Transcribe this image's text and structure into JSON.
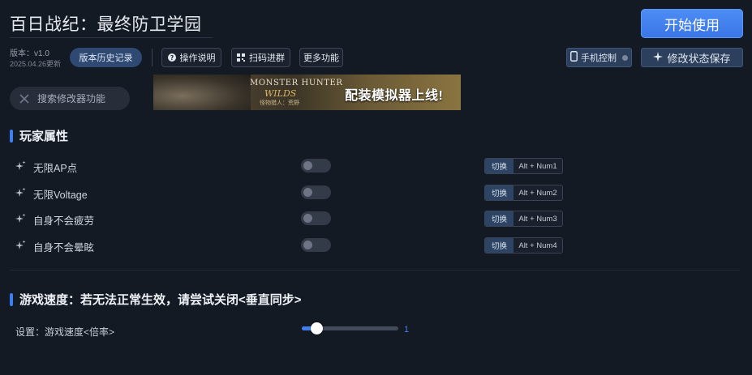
{
  "header": {
    "title": "百日战纪：最终防卫学园",
    "start_button": "开始使用",
    "version_label": "版本：v1.0",
    "version_date": "2025.04.26更新",
    "history_button": "版本历史记录",
    "instructions_button": "操作说明",
    "qr_button": "扫码进群",
    "more_button": "更多功能",
    "phone_button": "手机控制",
    "save_button": "修改状态保存"
  },
  "search": {
    "placeholder": "搜索修改器功能"
  },
  "banner": {
    "brand_line1": "MONSTER HUNTER",
    "brand_line2": "WILDS",
    "brand_line3": "怪物猎人：荒野",
    "headline": "配装模拟器上线!"
  },
  "player_section": {
    "title": "玩家属性",
    "toggle_label": "切换",
    "features": [
      {
        "name": "无限AP点",
        "hotkey": "Alt + Num1",
        "enabled": false
      },
      {
        "name": "无限Voltage",
        "hotkey": "Alt + Num2",
        "enabled": false
      },
      {
        "name": "自身不会疲劳",
        "hotkey": "Alt + Num3",
        "enabled": false
      },
      {
        "name": "自身不会晕眩",
        "hotkey": "Alt + Num4",
        "enabled": false
      }
    ]
  },
  "speed_section": {
    "title": "游戏速度：若无法正常生效，请尝试关闭<垂直同步>",
    "setting_label": "设置：游戏速度<倍率>",
    "value": "1",
    "fill_fraction": 0.15
  },
  "colors": {
    "accent": "#3f7ef0",
    "background": "#141a24"
  }
}
